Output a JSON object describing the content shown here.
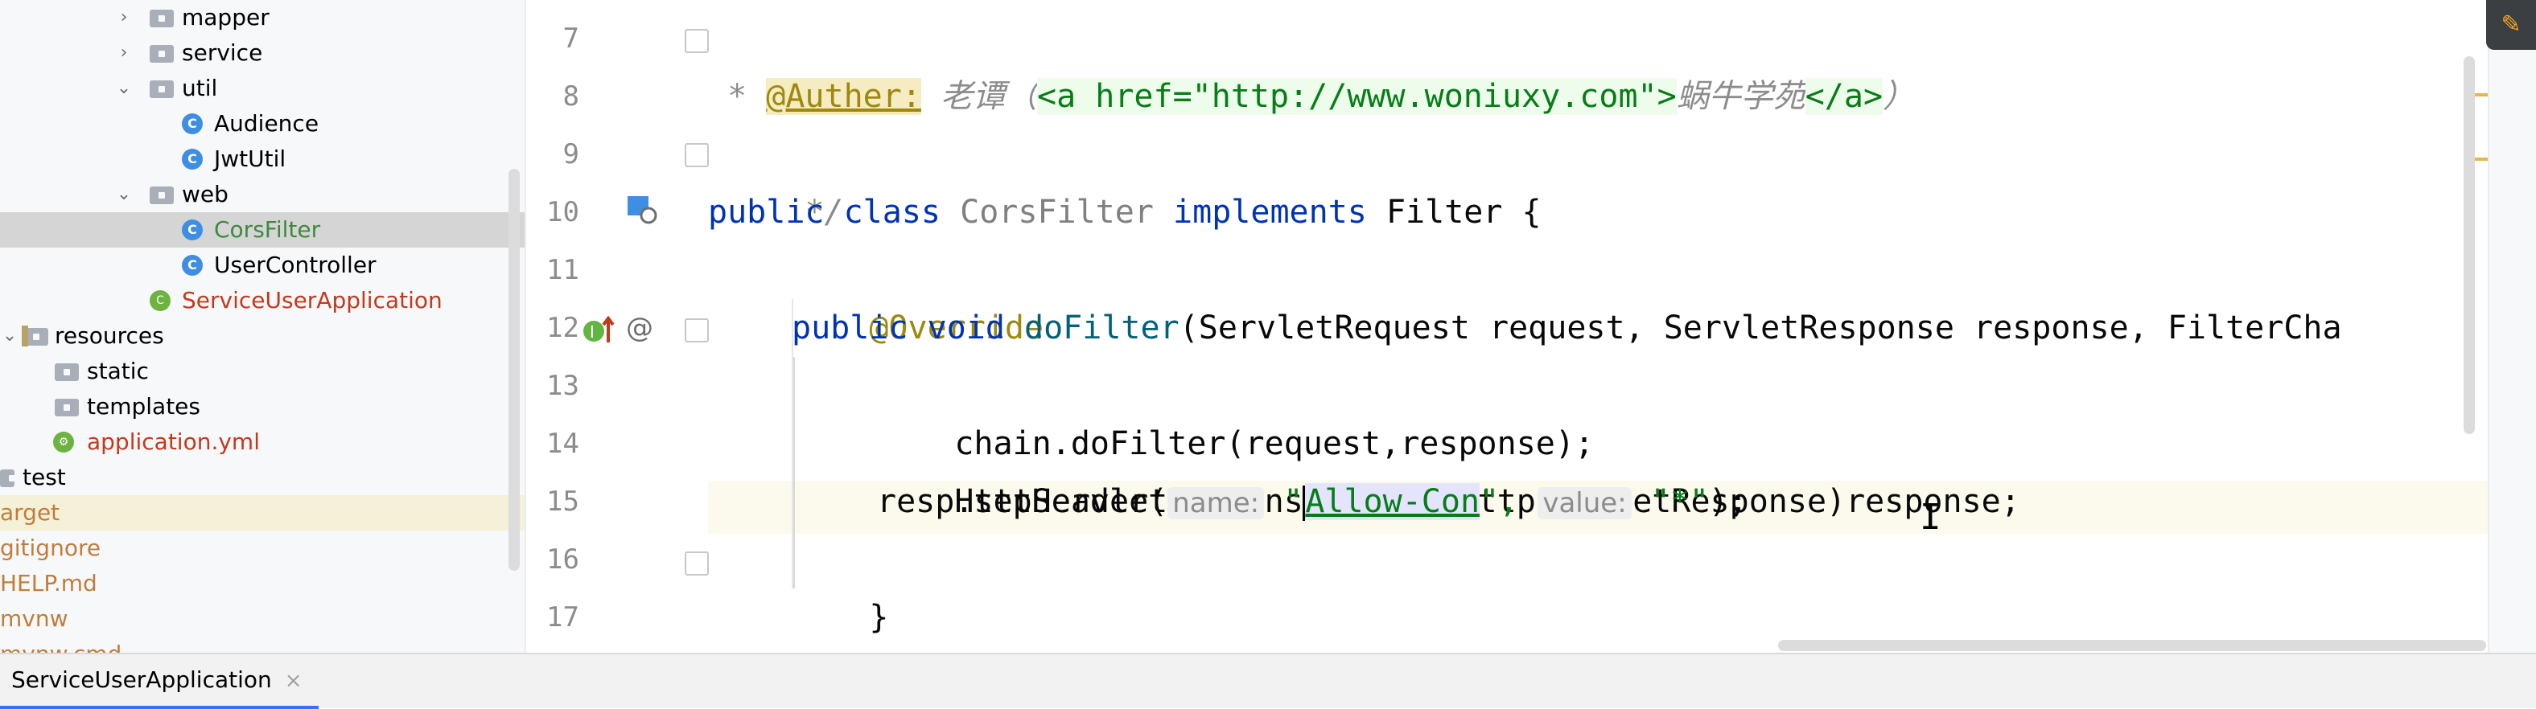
{
  "project_tree": [
    {
      "label": "mapper",
      "type": "folder",
      "expanded": false
    },
    {
      "label": "service",
      "type": "folder",
      "expanded": false
    },
    {
      "label": "util",
      "type": "folder",
      "expanded": true
    },
    {
      "label": "Audience",
      "type": "class"
    },
    {
      "label": "JwtUtil",
      "type": "class"
    },
    {
      "label": "web",
      "type": "folder",
      "expanded": true
    },
    {
      "label": "CorsFilter",
      "type": "class",
      "selected": true
    },
    {
      "label": "UserController",
      "type": "class"
    },
    {
      "label": "ServiceUserApplication",
      "type": "spring-class"
    },
    {
      "label": "resources",
      "type": "resource-folder",
      "expanded": true
    },
    {
      "label": "static",
      "type": "folder"
    },
    {
      "label": "templates",
      "type": "folder"
    },
    {
      "label": "application.yml",
      "type": "yml"
    },
    {
      "label": "test",
      "type": "folder"
    },
    {
      "label": "arget",
      "type": "excluded"
    },
    {
      "label": "gitignore",
      "type": "file"
    },
    {
      "label": "HELP.md",
      "type": "file"
    },
    {
      "label": "mvnw",
      "type": "file"
    },
    {
      "label": "mvnw.cmd",
      "type": "file"
    }
  ],
  "editor": {
    "line_numbers": [
      "7",
      "8",
      "9",
      "10",
      "11",
      "12",
      "13",
      "14",
      "15",
      "16",
      "17"
    ],
    "line7": "/**",
    "line8_star": " * ",
    "line8_tag": "@Auther:",
    "line8_author": " 老谭（",
    "line8_html_open": "<a href=\"http://www.woniuxy.com\">",
    "line8_site": "蜗牛学苑",
    "line8_html_close": "</a>",
    "line8_end": "）",
    "line9": " */",
    "line10_public": "public",
    "line10_class": "class",
    "line10_name": "CorsFilter",
    "line10_implements": "implements",
    "line10_rest": " Filter {",
    "line11": "@Override",
    "line12_public": "public",
    "line12_void": "void",
    "line12_method": "doFilter",
    "line12_rest": "(ServletRequest request, ServletResponse response, FilterCha",
    "line13": "chain.doFilter(request,response);",
    "line14": "HttpServletResponse resp=(HttpServletResponse)response;",
    "line15_call": "resp.setHeader(",
    "line15_hint_name": "name:",
    "line15_quote_open": "\"",
    "line15_arg1": "Allow-Con",
    "line15_quote_close": "\",",
    "line15_hint_value": "value:",
    "line15_arg2": "\"*\"",
    "line15_end": ");",
    "line16": "}",
    "line17": "}"
  },
  "bottom_bar": {
    "run_tab_label": "ServiceUserApplication",
    "run_tab_close": "×"
  },
  "colors": {
    "keyword": "#0033b3",
    "annotation": "#9e880d",
    "string": "#067d17",
    "comment": "#8c8c8c",
    "method": "#00627a",
    "selection": "#d5d5d5"
  }
}
